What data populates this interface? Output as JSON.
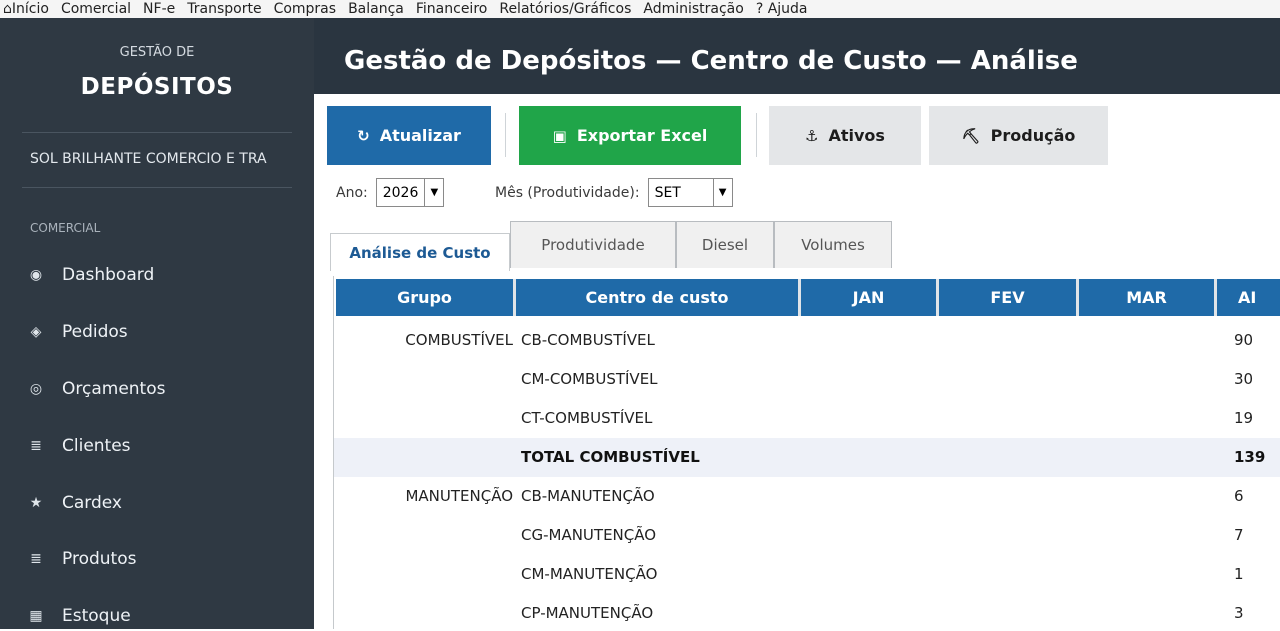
{
  "menu": {
    "items": [
      "Início",
      "Comercial",
      "NF-e",
      "Transporte",
      "Compras",
      "Balança",
      "Financeiro",
      "Relatórios/Gráficos",
      "Administração",
      "? Ajuda"
    ],
    "home_icon": "home-icon"
  },
  "sidebar": {
    "subtitle": "GESTÃO DE",
    "title": "DEPÓSITOS",
    "company": "SOL BRILHANTE COMERCIO E TRA",
    "section": "COMERCIAL",
    "items": [
      {
        "label": "Dashboard",
        "icon": "radio-icon",
        "glyph": "◉"
      },
      {
        "label": "Pedidos",
        "icon": "diamond-icon",
        "glyph": "◈"
      },
      {
        "label": "Orçamentos",
        "icon": "circle-icon",
        "glyph": "◎"
      },
      {
        "label": "Clientes",
        "icon": "list-icon",
        "glyph": "≣"
      },
      {
        "label": "Cardex",
        "icon": "star-icon",
        "glyph": "★"
      },
      {
        "label": "Produtos",
        "icon": "list-icon",
        "glyph": "≣"
      },
      {
        "label": "Estoque",
        "icon": "box-icon",
        "glyph": "▦"
      }
    ]
  },
  "header": {
    "title": "Gestão de Depósitos  —  Centro de Custo — Análise"
  },
  "toolbar": {
    "refresh_label": "Atualizar",
    "refresh_glyph": "↻",
    "export_label": "Exportar Excel",
    "export_glyph": "▣",
    "ativos_label": "Ativos",
    "ativos_glyph": "⚓",
    "producao_label": "Produção",
    "producao_glyph": "⛏"
  },
  "filters": {
    "year_label": "Ano:",
    "year_value": "2026",
    "month_label": "Mês (Produtividade):",
    "month_value": "SET"
  },
  "tabs": [
    "Análise de Custo",
    "Produtividade",
    "Diesel",
    "Volumes"
  ],
  "table": {
    "columns": [
      "Grupo",
      "Centro de custo",
      "JAN",
      "FEV",
      "MAR",
      "AI"
    ],
    "rows": [
      {
        "grupo": "COMBUSTÍVEL",
        "cc": "CB-COMBUSTÍVEL",
        "abr": "90",
        "total": false
      },
      {
        "grupo": "",
        "cc": "CM-COMBUSTÍVEL",
        "abr": "30",
        "total": false
      },
      {
        "grupo": "",
        "cc": "CT-COMBUSTÍVEL",
        "abr": "19",
        "total": false
      },
      {
        "grupo": "",
        "cc": "TOTAL COMBUSTÍVEL",
        "abr": "139",
        "total": true
      },
      {
        "grupo": "MANUTENÇÃO",
        "cc": "CB-MANUTENÇÃO",
        "abr": "6",
        "total": false
      },
      {
        "grupo": "",
        "cc": "CG-MANUTENÇÃO",
        "abr": "7",
        "total": false
      },
      {
        "grupo": "",
        "cc": "CM-MANUTENÇÃO",
        "abr": "1",
        "total": false
      },
      {
        "grupo": "",
        "cc": "CP-MANUTENÇÃO",
        "abr": "3",
        "total": false
      }
    ]
  },
  "colors": {
    "sidebar": "#2f3943",
    "header": "#2a3540",
    "accent_blue": "#1f6aa8",
    "accent_green": "#20a549",
    "tab_active_text": "#1d5a94"
  }
}
